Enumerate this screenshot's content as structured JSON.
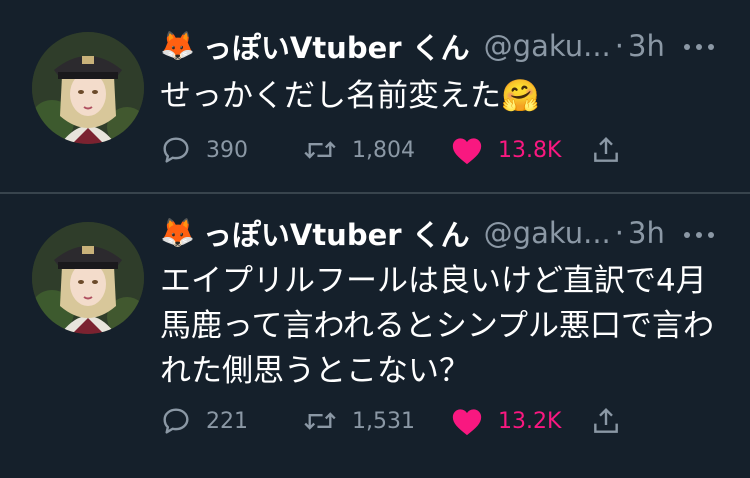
{
  "tweets": [
    {
      "author": {
        "emoji": "🦊",
        "display_name": "っぽいVtuber くん",
        "handle": "@gaku...",
        "separator": "·",
        "time": "3h"
      },
      "text": "せっかくだし名前変えた🤗",
      "stats": {
        "replies": "390",
        "retweets": "1,804",
        "likes": "13.8K",
        "liked": true
      }
    },
    {
      "author": {
        "emoji": "🦊",
        "display_name": "っぽいVtuber くん",
        "handle": "@gaku...",
        "separator": "·",
        "time": "3h"
      },
      "text": "エイプリルフールは良いけど直訳で4月馬鹿って言われるとシンプル悪口で言われた側思うとこない？",
      "stats": {
        "replies": "221",
        "retweets": "1,531",
        "likes": "13.2K",
        "liked": true
      }
    }
  ],
  "icons": {
    "reply": "reply-icon",
    "retweet": "retweet-icon",
    "like": "heart-icon",
    "share": "share-icon",
    "more": "more-icon"
  },
  "colors": {
    "background": "#15202b",
    "divider": "#38444d",
    "muted_text": "#8b98a5",
    "like_active": "#f91880",
    "primary_text": "#ffffff"
  }
}
